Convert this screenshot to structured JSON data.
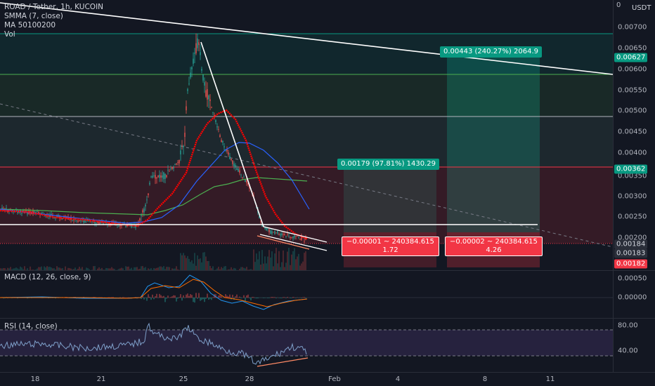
{
  "legend": {
    "symbol": "ROAD / Tether, 1h, KUCOIN",
    "indicators": [
      "SMMA (7, close)",
      "MA 50100200",
      "Vol"
    ]
  },
  "macd": {
    "label": "MACD (12, 26, close, 9)"
  },
  "rsi": {
    "label": "RSI (14, close)"
  },
  "price_axis": {
    "currency": "USDT",
    "ticks": [
      "0.00700",
      "0.00650",
      "0.00600",
      "0.00550",
      "0.00500",
      "0.00450",
      "0.00400",
      "0.00350",
      "0.00300",
      "0.00250",
      "0.00200"
    ],
    "tags": [
      {
        "text": "0.00627",
        "color": "#089981"
      },
      {
        "text": "0.00362",
        "color": "#089981"
      },
      {
        "text": "0.00184",
        "color": "#2a2e39"
      },
      {
        "text": "0.00183",
        "color": "#2a2e39"
      },
      {
        "text": "0.00182",
        "color": "#f23645"
      }
    ]
  },
  "macd_axis": {
    "ticks": [
      "0.00050",
      "0.00000"
    ]
  },
  "rsi_axis": {
    "ticks": [
      "80.00",
      "40.00"
    ]
  },
  "time_axis": {
    "ticks": [
      "18",
      "21",
      "25",
      "28",
      "Feb",
      "4",
      "8",
      "11"
    ]
  },
  "positions": [
    {
      "profit_label": "0.00179 (97.81%) 1430.29",
      "loss_label_1": "−0.00001 ~ 240384.615",
      "loss_label_2": "1.72"
    },
    {
      "profit_label": "0.00443 (240.27%) 2064.9",
      "loss_label_1": "−0.00002 ~ 240384.615",
      "loss_label_2": "4.26"
    }
  ],
  "colors": {
    "background": "#131722",
    "profit": "#089981",
    "loss": "#f23645",
    "smma": "#ff0000",
    "ma": "#2962ff",
    "ma_slow": "#4caf50",
    "trendline": "#ffffff",
    "rsi_line": "#7e9fc9",
    "rsi_band": "#7e57c2"
  }
}
